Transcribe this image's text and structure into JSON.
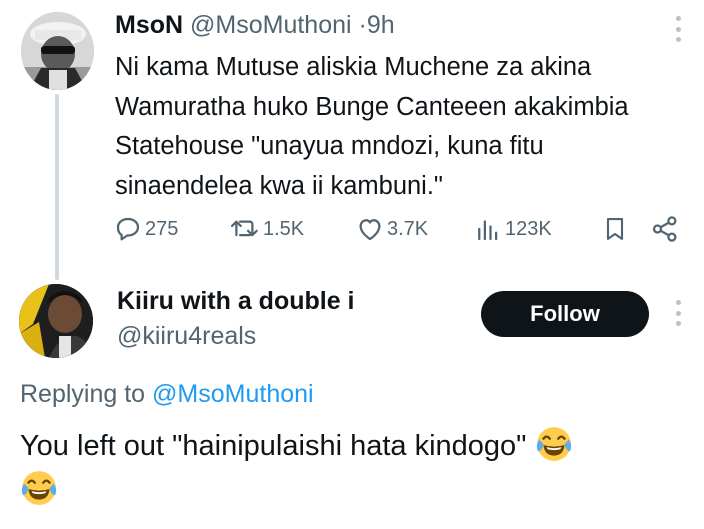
{
  "tweet": {
    "author_name": "MsoN",
    "author_handle": "@MsoMuthoni",
    "separator": "·",
    "time": "9h",
    "text": "Ni kama Mutuse aliskia Muchene za akina\nWamuratha huko Bunge Canteeen akakimbia\nStatehouse \"unayua mndozi, kuna fitu\nsinaendelea kwa ii kambuni.\"",
    "stats": {
      "replies": "275",
      "retweets": "1.5K",
      "likes": "3.7K",
      "views": "123K"
    }
  },
  "reply": {
    "author_name": "Kiiru with a double i",
    "author_handle": "@kiiru4reals",
    "follow_label": "Follow",
    "replying_prefix": "Replying to",
    "replying_to": "@MsoMuthoni",
    "text": "You left out \"hainipulaishi hata kindogo\""
  },
  "icons": {
    "reply": "comment-bubble-icon",
    "retweet": "retweet-icon",
    "like": "heart-icon",
    "views": "views-bar-icon",
    "bookmark": "bookmark-icon",
    "share": "share-icon",
    "more": "more-vertical-icon",
    "emoji": "face-with-tears-of-joy-emoji"
  },
  "colors": {
    "text": "#0f1419",
    "secondary": "#536471",
    "mention": "#1d9bf0",
    "follow_bg": "#0f1419"
  }
}
